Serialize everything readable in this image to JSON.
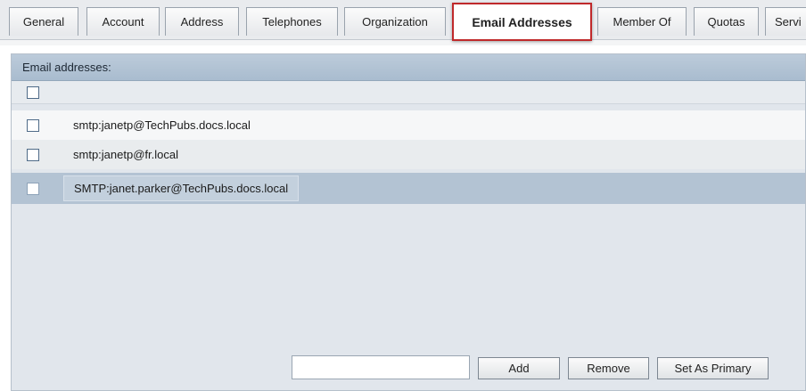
{
  "tabs": [
    {
      "label": "General",
      "active": false
    },
    {
      "label": "Account",
      "active": false
    },
    {
      "label": "Address",
      "active": false
    },
    {
      "label": "Telephones",
      "active": false
    },
    {
      "label": "Organization",
      "active": false
    },
    {
      "label": "Email Addresses",
      "active": true
    },
    {
      "label": "Member Of",
      "active": false
    },
    {
      "label": "Quotas",
      "active": false
    },
    {
      "label": "Servi",
      "active": false
    }
  ],
  "panel": {
    "header": "Email addresses:",
    "addresses": [
      {
        "value": "smtp:janetp@TechPubs.docs.local",
        "checked": false,
        "selected": false
      },
      {
        "value": "smtp:janetp@fr.local",
        "checked": false,
        "selected": false
      },
      {
        "value": "SMTP:janet.parker@TechPubs.docs.local",
        "checked": false,
        "selected": true
      }
    ]
  },
  "controls": {
    "input_value": "",
    "add_label": "Add",
    "remove_label": "Remove",
    "set_primary_label": "Set As Primary"
  },
  "colors": {
    "active_tab_border": "#c0292b",
    "panel_background": "#e1e6ec",
    "selected_row": "#b3c3d3"
  }
}
